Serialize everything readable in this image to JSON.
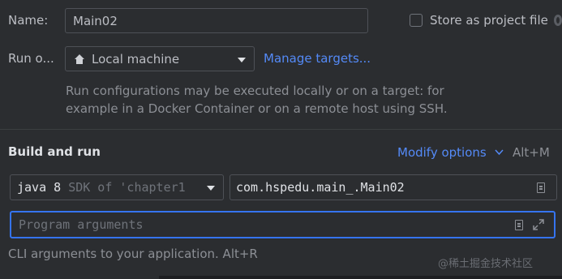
{
  "name_row": {
    "label": "Name:",
    "value": "Main02",
    "store_label": "Store as project file"
  },
  "run_on": {
    "label": "Run o...",
    "selected": "Local machine",
    "manage_link": "Manage targets...",
    "help_line1": "Run configurations may be executed locally or on a target: for",
    "help_line2": "example in a Docker Container or on a remote host using SSH."
  },
  "build_run": {
    "heading": "Build and run",
    "modify_options": "Modify options",
    "modify_shortcut": "Alt+M",
    "sdk_main": "java 8",
    "sdk_detail": "SDK of 'chapter1",
    "main_class": "com.hspedu.main_.Main02",
    "program_args_placeholder": "Program arguments",
    "args_hint": "CLI arguments to your application. Alt+R"
  },
  "watermark": "@稀土掘金技术社区",
  "colors": {
    "link": "#548af7",
    "focus_border": "#3574f0",
    "background": "#2b2d30"
  }
}
